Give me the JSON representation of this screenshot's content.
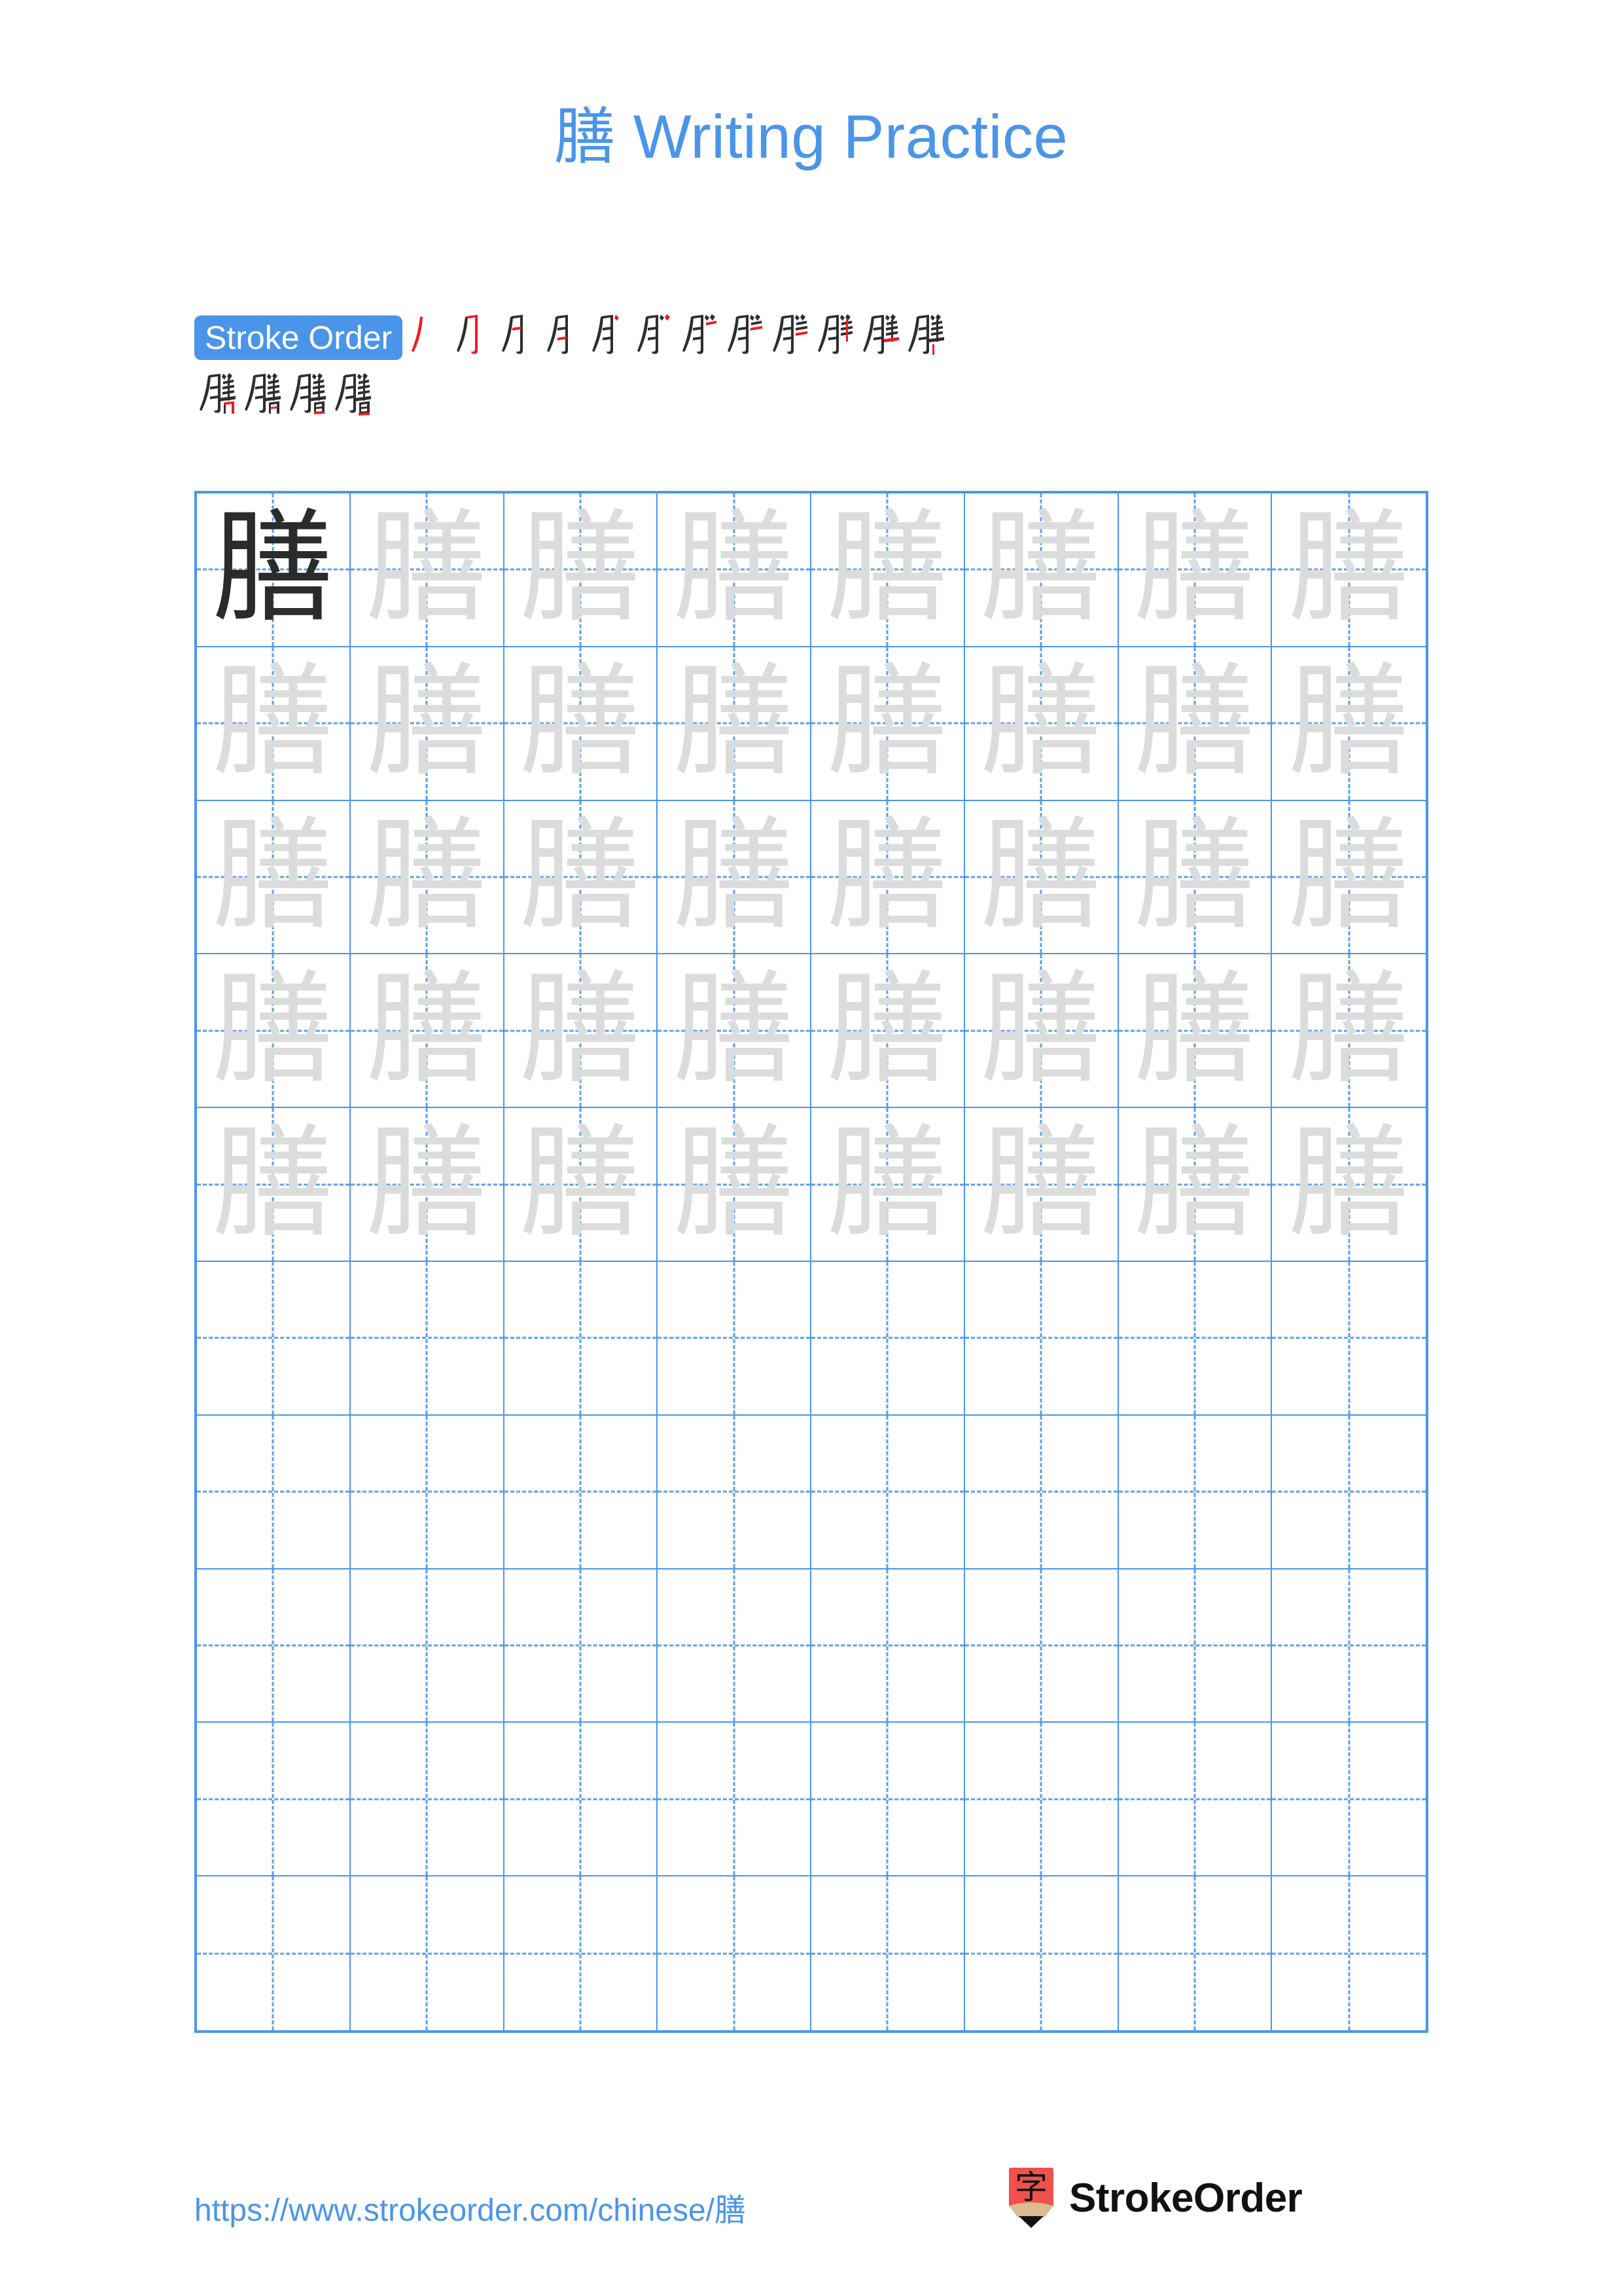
{
  "page": {
    "character": "膳",
    "title": "膳 Writing Practice",
    "background_color": "#ffffff",
    "accent_color": "#4a95ea"
  },
  "stroke_order": {
    "badge_label": "Stroke Order",
    "total_strokes": 16,
    "new_stroke_color": "#ee1c24",
    "previous_stroke_color": "#2e2e2e",
    "steps": [
      {
        "index": 1,
        "glyph": "丿"
      },
      {
        "index": 2,
        "glyph": "⺁"
      },
      {
        "index": 3,
        "glyph": "月"
      },
      {
        "index": 4,
        "glyph": "月"
      },
      {
        "index": 5,
        "glyph": "月"
      },
      {
        "index": 6,
        "glyph": "月"
      },
      {
        "index": 7,
        "glyph": "月"
      },
      {
        "index": 8,
        "glyph": "朋"
      },
      {
        "index": 9,
        "glyph": "朋"
      },
      {
        "index": 10,
        "glyph": "胖"
      },
      {
        "index": 11,
        "glyph": "胖"
      },
      {
        "index": 12,
        "glyph": "膳"
      },
      {
        "index": 13,
        "glyph": "膳"
      },
      {
        "index": 14,
        "glyph": "膳"
      },
      {
        "index": 15,
        "glyph": "膳"
      },
      {
        "index": 16,
        "glyph": "膳"
      }
    ],
    "row_split": [
      12,
      4
    ]
  },
  "practice_grid": {
    "columns": 8,
    "rows": 10,
    "cell_border_color": "#4a95ea",
    "guide_line_color": "#4a95ea",
    "model_char_color": "#2b2b2b",
    "trace_char_color": "#dcdcdc",
    "filled_rows": 5,
    "empty_rows": 5,
    "model_cell": {
      "row": 1,
      "col": 1,
      "char": "膳"
    },
    "trace_char": "膳"
  },
  "footer": {
    "url": "https://www.strokeorder.com/chinese/膳",
    "brand_name": "StrokeOrder",
    "logo_char": "字",
    "logo_body_color": "#f0514c",
    "logo_wood_color": "#ddba91",
    "logo_tip_color": "#111111"
  }
}
